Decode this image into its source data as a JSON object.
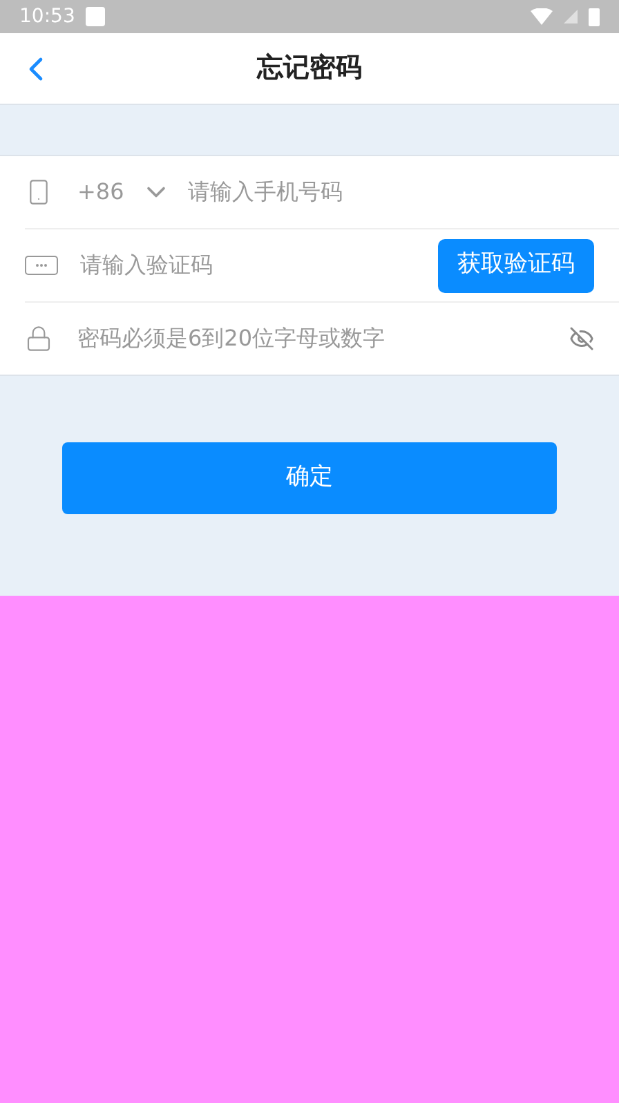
{
  "status_bar": {
    "time": "10:53"
  },
  "header": {
    "title": "忘记密码"
  },
  "form": {
    "country_code": "+86",
    "phone": {
      "placeholder": "请输入手机号码"
    },
    "code": {
      "placeholder": "请输入验证码"
    },
    "get_code_button": "获取验证码",
    "password": {
      "placeholder": "密码必须是6到20位字母或数字"
    }
  },
  "confirm_button": "确定"
}
